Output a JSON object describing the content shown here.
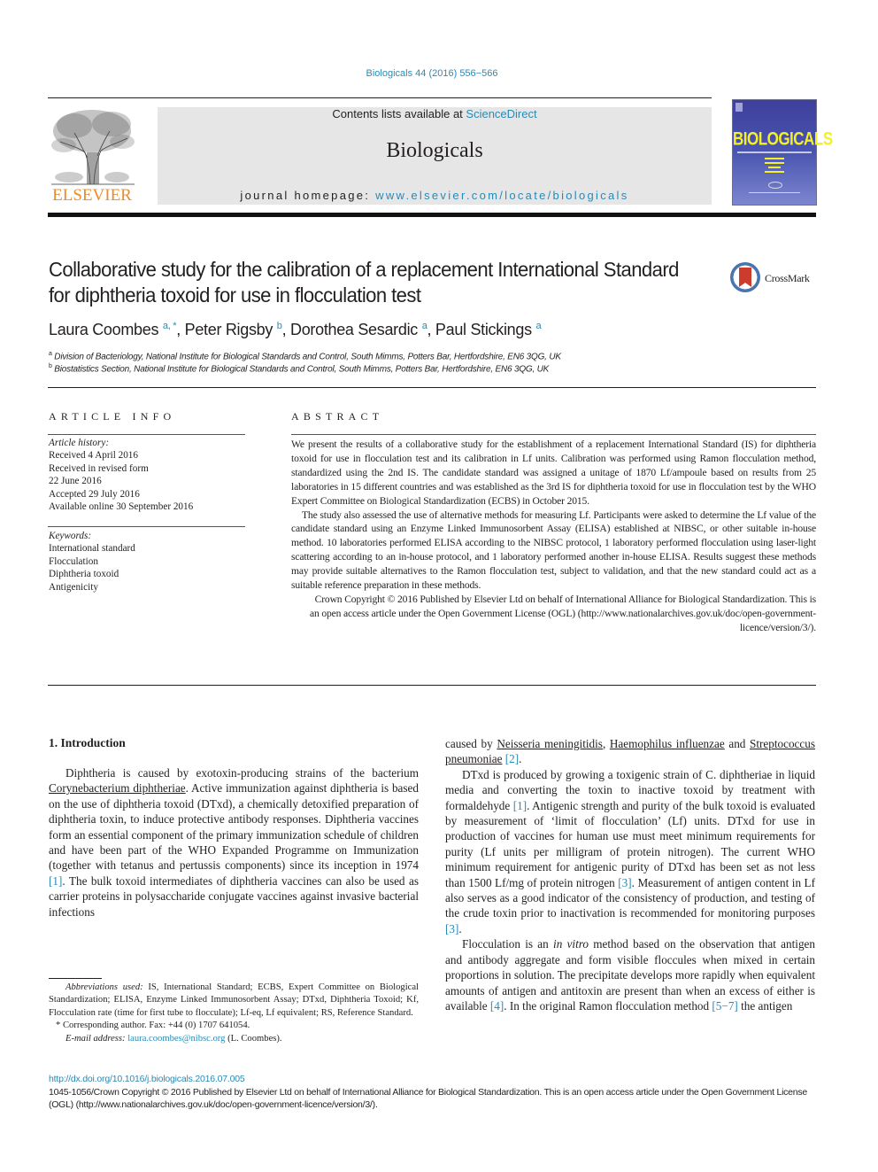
{
  "header": {
    "citation": "Biologicals 44 (2016) 556−566",
    "publisher_logo_text": "ELSEVIER",
    "contents_prefix": "Contents lists available at ",
    "contents_link": "ScienceDirect",
    "journal_name": "Biologicals",
    "homepage_prefix": "journal homepage: ",
    "homepage_link": "www.elsevier.com/locate/biologicals",
    "cover_title": "BIOLOGICALS",
    "crossmark_label": "CrossMark"
  },
  "article": {
    "title": "Collaborative study for the calibration of a replacement International Standard for diphtheria toxoid for use in flocculation test",
    "authors": [
      {
        "name": "Laura Coombes",
        "sup": "a, *"
      },
      {
        "name": "Peter Rigsby",
        "sup": "b"
      },
      {
        "name": "Dorothea Sesardic",
        "sup": "a"
      },
      {
        "name": "Paul Stickings",
        "sup": "a"
      }
    ],
    "affiliations": [
      {
        "key": "a",
        "text": "Division of Bacteriology, National Institute for Biological Standards and Control, South Mimms, Potters Bar, Hertfordshire, EN6 3QG, UK"
      },
      {
        "key": "b",
        "text": "Biostatistics Section, National Institute for Biological Standards and Control, South Mimms, Potters Bar, Hertfordshire, EN6 3QG, UK"
      }
    ]
  },
  "article_info": {
    "heading": "ARTICLE INFO",
    "history_label": "Article history:",
    "history": [
      "Received 4 April 2016",
      "Received in revised form",
      "22 June 2016",
      "Accepted 29 July 2016",
      "Available online 30 September 2016"
    ],
    "keywords_label": "Keywords:",
    "keywords": [
      "International standard",
      "Flocculation",
      "Diphtheria toxoid",
      "Antigenicity"
    ]
  },
  "abstract": {
    "heading": "ABSTRACT",
    "paragraphs": [
      "We present the results of a collaborative study for the establishment of a replacement International Standard (IS) for diphtheria toxoid for use in flocculation test and its calibration in Lf units. Calibration was performed using Ramon flocculation method, standardized using the 2nd IS. The candidate standard was assigned a unitage of 1870 Lf/ampoule based on results from 25 laboratories in 15 different countries and was established as the 3rd IS for diphtheria toxoid for use in flocculation test by the WHO Expert Committee on Biological Standardization (ECBS) in October 2015.",
      "The study also assessed the use of alternative methods for measuring Lf. Participants were asked to determine the Lf value of the candidate standard using an Enzyme Linked Immunosorbent Assay (ELISA) established at NIBSC, or other suitable in-house method. 10 laboratories performed ELISA according to the NIBSC protocol, 1 laboratory performed flocculation using laser-light scattering according to an in-house protocol, and 1 laboratory performed another in-house ELISA. Results suggest these methods may provide suitable alternatives to the Ramon flocculation test, subject to validation, and that the new standard could act as a suitable reference preparation in these methods."
    ],
    "copyright": "Crown Copyright © 2016 Published by Elsevier Ltd on behalf of International Alliance for Biological Standardization. This is an open access article under the Open Government License (OGL) (http://www.nationalarchives.gov.uk/doc/open-government-licence/version/3/)."
  },
  "introduction": {
    "heading": "1.  Introduction",
    "p1": {
      "t1": "Diphtheria is caused by exotoxin-producing strains of the bacterium ",
      "organism": "Corynebacterium diphtheriae",
      "t2": ". Active immunization against diphtheria is based on the use of diphtheria toxoid (DTxd), a chemically detoxified preparation of diphtheria toxin, to induce protective antibody responses. Diphtheria vaccines form an essential component of the primary immunization schedule of children and have been part of the WHO Expanded Programme on Immunization (together with tetanus and pertussis components) since its inception in 1974 ",
      "ref1": "[1]",
      "t3": ". The bulk toxoid intermediates of diphtheria vaccines can also be used as carrier proteins in polysaccharide conjugate vaccines against invasive bacterial infections"
    },
    "p1_cont": {
      "t1": "caused by ",
      "org1": "Neisseria meningitidis",
      "t2": ", ",
      "org2": "Haemophilus influenzae",
      "t3": " and ",
      "org3": "Streptococcus pneumoniae",
      "t4": " ",
      "ref": "[2]",
      "t5": "."
    },
    "p2": {
      "t1": "DTxd is produced by growing a toxigenic strain of C. diphtheriae in liquid media and converting the toxin to inactive toxoid by treatment with formaldehyde ",
      "ref1": "[1]",
      "t2": ". Antigenic strength and purity of the bulk toxoid is evaluated by measurement of ‘limit of flocculation’ (Lf) units. DTxd for use in production of vaccines for human use must meet minimum requirements for purity (Lf units per milligram of protein nitrogen). The current WHO minimum requirement for antigenic purity of DTxd has been set as not less than 1500 Lf/mg of protein nitrogen ",
      "ref2": "[3]",
      "t3": ". Measurement of antigen content in Lf also serves as a good indicator of the consistency of production, and testing of the crude toxin prior to inactivation is recommended for monitoring purposes ",
      "ref3": "[3]",
      "t4": "."
    },
    "p3": {
      "t1": "Flocculation is an ",
      "em": "in vitro",
      "t2": " method based on the observation that antigen and antibody aggregate and form visible floccules when mixed in certain proportions in solution. The precipitate develops more rapidly when equivalent amounts of antigen and antitoxin are present than when an excess of either is available ",
      "ref1": "[4]",
      "t3": ". In the original Ramon flocculation method ",
      "ref2": "[5−7]",
      "t4": " the antigen"
    }
  },
  "footnotes": {
    "abbrev_label": "Abbreviations used:",
    "abbrev_text": " IS, International Standard; ECBS, Expert Committee on Biological Standardization; ELISA, Enzyme Linked Immunosorbent Assay; DTxd, Diphtheria Toxoid; Kf, Flocculation rate (time for first tube to flocculate); Lf-eq, Lf equivalent; RS, Reference Standard.",
    "corresponding": "* Corresponding author. Fax: +44 (0) 1707 641054.",
    "email_label": "E-mail address:",
    "email": "laura.coombes@nibsc.org",
    "email_suffix": " (L. Coombes)."
  },
  "footer": {
    "doi": "http://dx.doi.org/10.1016/j.biologicals.2016.07.005",
    "copyright": "1045-1056/Crown Copyright © 2016 Published by Elsevier Ltd on behalf of International Alliance for Biological Standardization. This is an open access article under the Open Government License (OGL) (http://www.nationalarchives.gov.uk/doc/open-government-licence/version/3/)."
  },
  "colors": {
    "link": "#2a8ab5",
    "elsevier_orange": "#f08a24",
    "banner_gray": "#e6e6e6",
    "cover_blue": "#3e3f9c",
    "cover_yellow": "#f5ef25",
    "crossmark_red": "#cc3b2b"
  }
}
